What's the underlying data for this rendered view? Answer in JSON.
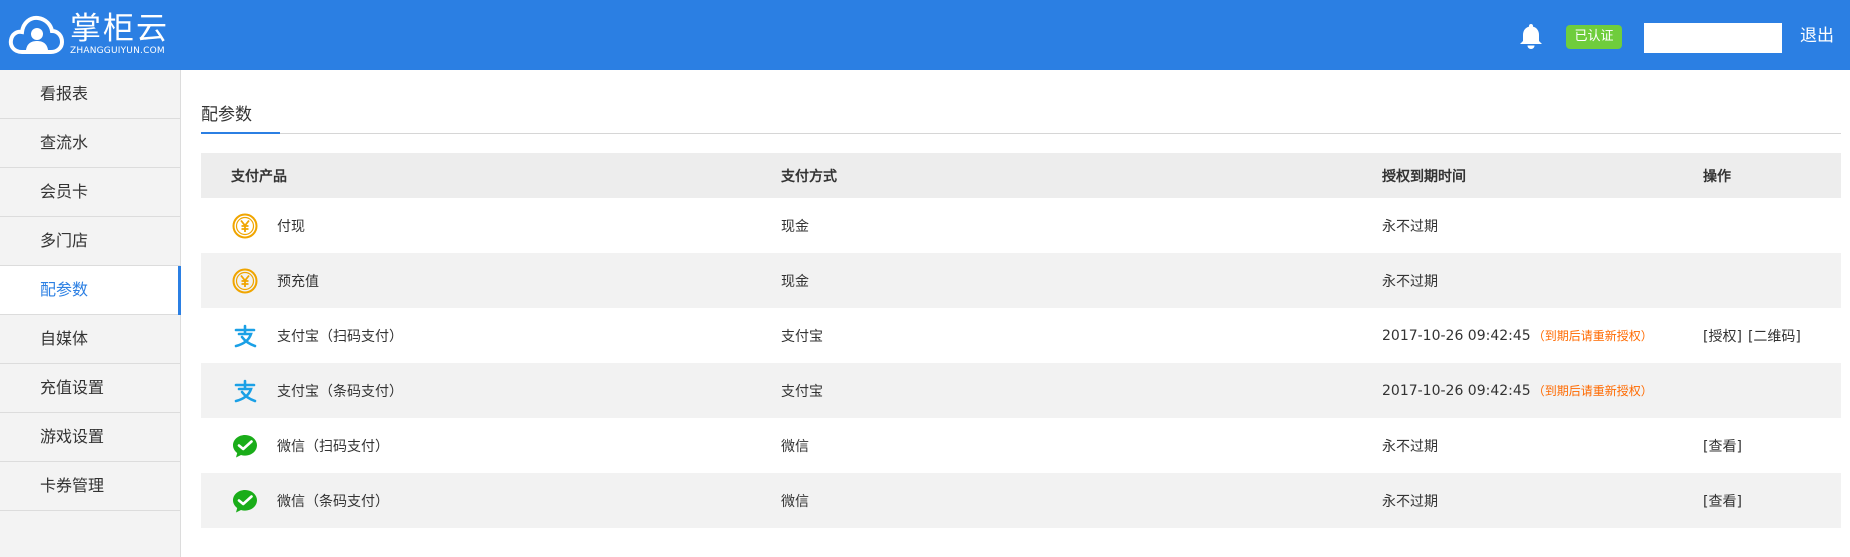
{
  "header": {
    "logo_title": "掌柜云",
    "logo_subtitle": "ZHANGGUIYUN.COM",
    "verified_badge": "已认证",
    "account_value": "",
    "logout_label": "退出"
  },
  "sidebar": {
    "items": [
      {
        "label": "看报表"
      },
      {
        "label": "查流水"
      },
      {
        "label": "会员卡"
      },
      {
        "label": "多门店"
      },
      {
        "label": "配参数",
        "active": true
      },
      {
        "label": "自媒体"
      },
      {
        "label": "充值设置"
      },
      {
        "label": "游戏设置"
      },
      {
        "label": "卡券管理"
      }
    ]
  },
  "main": {
    "tab_label": "配参数",
    "table": {
      "headers": [
        "支付产品",
        "支付方式",
        "授权到期时间",
        "操作"
      ],
      "rows": [
        {
          "icon": "yuan-coin-icon",
          "product": "付现",
          "method": "现金",
          "expiry": "永不过期",
          "note": "",
          "actions": []
        },
        {
          "icon": "yuan-coin-icon",
          "product": "预充值",
          "method": "现金",
          "expiry": "永不过期",
          "note": "",
          "actions": []
        },
        {
          "icon": "alipay-icon",
          "product": "支付宝（扫码支付）",
          "method": "支付宝",
          "expiry": "2017-10-26 09:42:45",
          "note": "（到期后请重新授权）",
          "actions": [
            "[授权]",
            "[二维码]"
          ]
        },
        {
          "icon": "alipay-icon",
          "product": "支付宝（条码支付）",
          "method": "支付宝",
          "expiry": "2017-10-26 09:42:45",
          "note": "（到期后请重新授权）",
          "actions": []
        },
        {
          "icon": "wechat-icon",
          "product": "微信（扫码支付）",
          "method": "微信",
          "expiry": "永不过期",
          "note": "",
          "actions": [
            "[查看]"
          ]
        },
        {
          "icon": "wechat-icon",
          "product": "微信（条码支付）",
          "method": "微信",
          "expiry": "永不过期",
          "note": "",
          "actions": [
            "[查看]"
          ]
        }
      ]
    }
  },
  "colors": {
    "header_bg": "#2b7fe3",
    "accent": "#2b7fe3",
    "badge_bg": "#6fcd3c",
    "warning": "#ff6a00",
    "coin": "#f0a500",
    "alipay": "#1aa0e6",
    "wechat": "#1aad19"
  }
}
